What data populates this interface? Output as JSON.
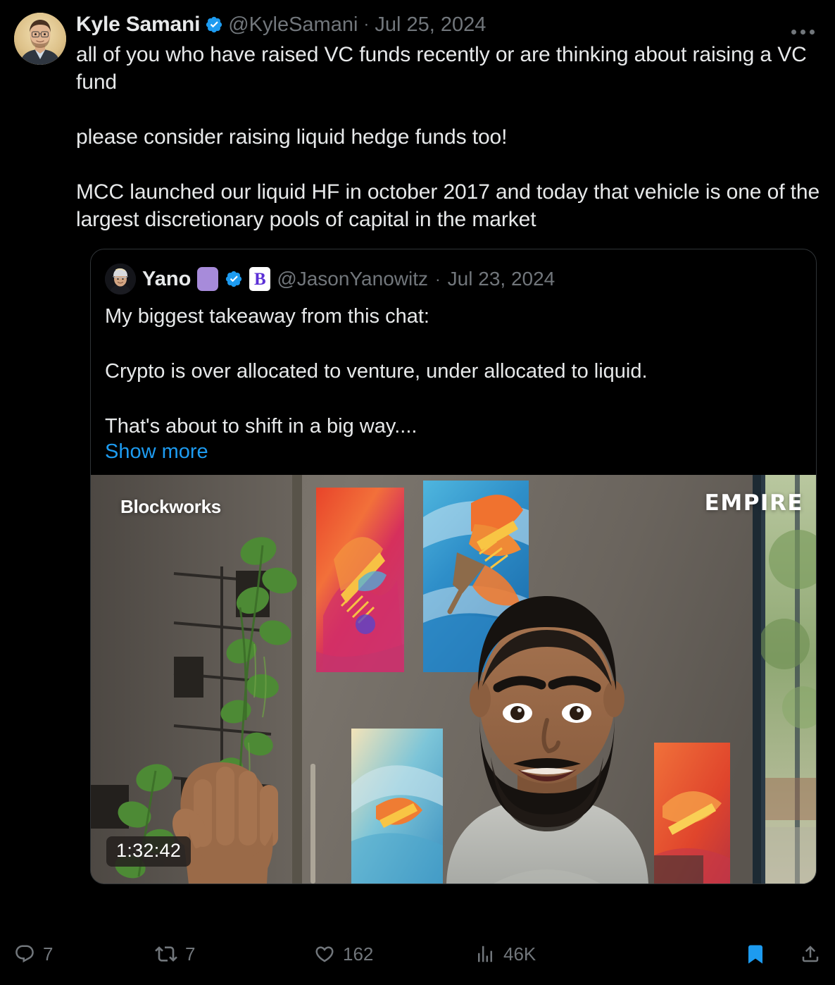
{
  "colors": {
    "background": "#000000",
    "text_primary": "#e7e9ea",
    "text_muted": "#71767b",
    "accent_blue": "#1d9bf0",
    "card_border": "#2f3336",
    "affiliate_purple": "#5b2fd6",
    "emoji_purple": "#a78bda"
  },
  "tweet": {
    "author": {
      "display_name": "Kyle Samani",
      "handle": "@KyleSamani",
      "verified_badge": "verified-badge-icon",
      "avatar": "avatar-kyle-samani"
    },
    "separator": "·",
    "date": "Jul 25, 2024",
    "more_menu": "more-options-icon",
    "text": "all of you who have raised VC funds recently or are thinking about raising a VC fund\n\nplease consider raising liquid hedge funds too!\n\nMCC launched our liquid HF in october 2017 and today that vehicle is one of the largest discretionary pools of capital in the market"
  },
  "quoted_tweet": {
    "author": {
      "display_name": "Yano",
      "emoji_badge": "purple-square-emoji",
      "verified_badge": "verified-badge-icon",
      "affiliate_badge_letter": "B",
      "affiliate_badge_name": "blockworks-affiliate-badge",
      "handle": "@JasonYanowitz",
      "avatar": "avatar-jason-yanowitz"
    },
    "separator": "·",
    "date": "Jul 23, 2024",
    "text": "My biggest takeaway from this chat:\n\nCrypto is over allocated to venture, under allocated to liquid.\n\nThat's about to shift in a big way....",
    "show_more_label": "Show more",
    "video": {
      "brand_overlay": "Blockworks",
      "show_overlay": "EMPIRE",
      "duration": "1:32:42"
    }
  },
  "actions": {
    "reply": {
      "icon": "reply-icon",
      "count": "7"
    },
    "retweet": {
      "icon": "retweet-icon",
      "count": "7"
    },
    "like": {
      "icon": "heart-icon",
      "count": "162"
    },
    "views": {
      "icon": "analytics-icon",
      "count": "46K"
    },
    "bookmark": {
      "icon": "bookmark-filled-icon",
      "state": "saved"
    },
    "share": {
      "icon": "share-icon"
    }
  }
}
